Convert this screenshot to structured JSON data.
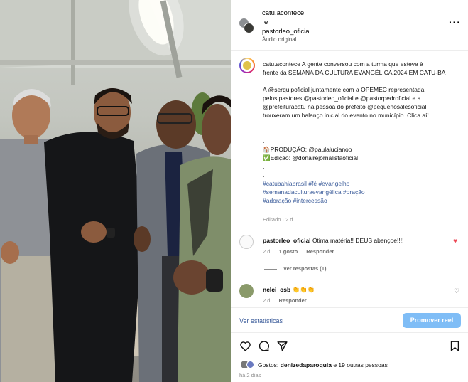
{
  "header": {
    "user1": "catu.acontece",
    "conj": "e",
    "user2": "pastorleo_oficial",
    "audio": "Áudio original"
  },
  "caption": {
    "lines": [
      "catu.acontece A gente conversou com a turma que esteve à",
      "frente da SEMANA DA CULTURA EVANGÉLICA 2024 EM CATU-BA",
      "",
      "A @serquipoficial juntamente com a OPEMEC representada",
      "pelos pastores @pastorleo_oficial e @pastorpedroficial e a",
      "@prefeituracatu na pessoa do prefeito @pequenosalesoficial",
      "trouxeram um balanço inicial do evento no município. Clica aí!",
      "",
      ".",
      ".",
      "🏠PRODUÇÃO: @paulalucianoo",
      "✅Edição: @donairejornalistaoficial",
      ".",
      ".",
      "#catubahiabrasil #fé #evangelho",
      "#semanadaculturaevangélica #oração",
      "#adoração #intercessão"
    ],
    "meta": "Editado · 2 d"
  },
  "comments": [
    {
      "user": "pastorleo_oficial",
      "text": "Ótima matéria!! DEUS abençoe!!!!",
      "age": "2 d",
      "likes": "1 gosto",
      "reply": "Responder",
      "view_replies": "Ver respostas (1)"
    },
    {
      "user": "nelci_osb",
      "text": "👏👏👏",
      "age": "2 d",
      "reply": "Responder"
    }
  ],
  "stats": {
    "view_stats": "Ver estatísticas",
    "promote": "Promover reel"
  },
  "footer": {
    "likes_prefix": "Gostos:",
    "likes_user": "denizedaparoquia",
    "likes_rest": "e 19 outras pessoas",
    "time": "há 2 dias"
  },
  "colors": {
    "link": "#3a5b9a",
    "promote_button": "#7fbdf6",
    "liked_heart": "#ed4956"
  },
  "icons": [
    "more-options-icon",
    "heart-icon",
    "comment-icon",
    "share-icon",
    "bookmark-icon"
  ]
}
